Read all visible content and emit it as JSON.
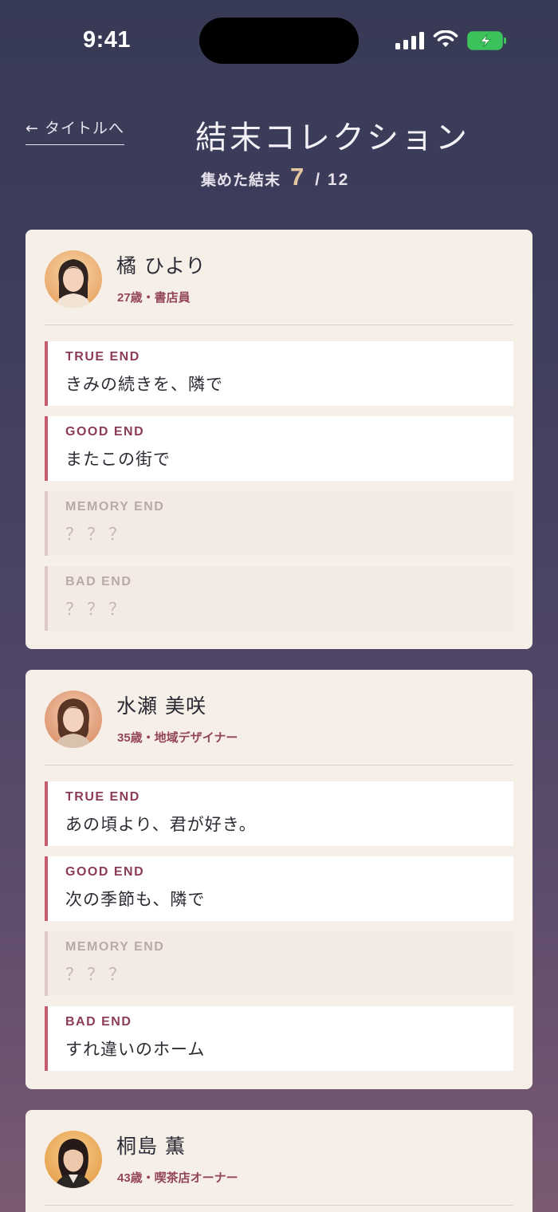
{
  "status_bar": {
    "time": "9:41"
  },
  "header": {
    "back_label": "← タイトルへ",
    "title": "結末コレクション",
    "collected_label": "集めた結末",
    "collected_count": "7",
    "collected_total": "/ 12"
  },
  "characters": [
    {
      "name": "橘 ひより",
      "meta": "27歳・書店員",
      "endings": [
        {
          "type": "TRUE END",
          "title": "きみの続きを、隣で",
          "unlocked": true
        },
        {
          "type": "GOOD END",
          "title": "またこの街で",
          "unlocked": true
        },
        {
          "type": "MEMORY END",
          "title": "？？？",
          "unlocked": false
        },
        {
          "type": "BAD END",
          "title": "？？？",
          "unlocked": false
        }
      ]
    },
    {
      "name": "水瀬 美咲",
      "meta": "35歳・地域デザイナー",
      "endings": [
        {
          "type": "TRUE END",
          "title": "あの頃より、君が好き。",
          "unlocked": true
        },
        {
          "type": "GOOD END",
          "title": "次の季節も、隣で",
          "unlocked": true
        },
        {
          "type": "MEMORY END",
          "title": "？？？",
          "unlocked": false
        },
        {
          "type": "BAD END",
          "title": "すれ違いのホーム",
          "unlocked": true
        }
      ]
    },
    {
      "name": "桐島 薫",
      "meta": "43歳・喫茶店オーナー",
      "endings": []
    }
  ],
  "colors": {
    "accent": "#c75b70",
    "meta_text": "#93465a",
    "card_bg": "#f6efe8",
    "count_highlight": "#e3c79f"
  }
}
